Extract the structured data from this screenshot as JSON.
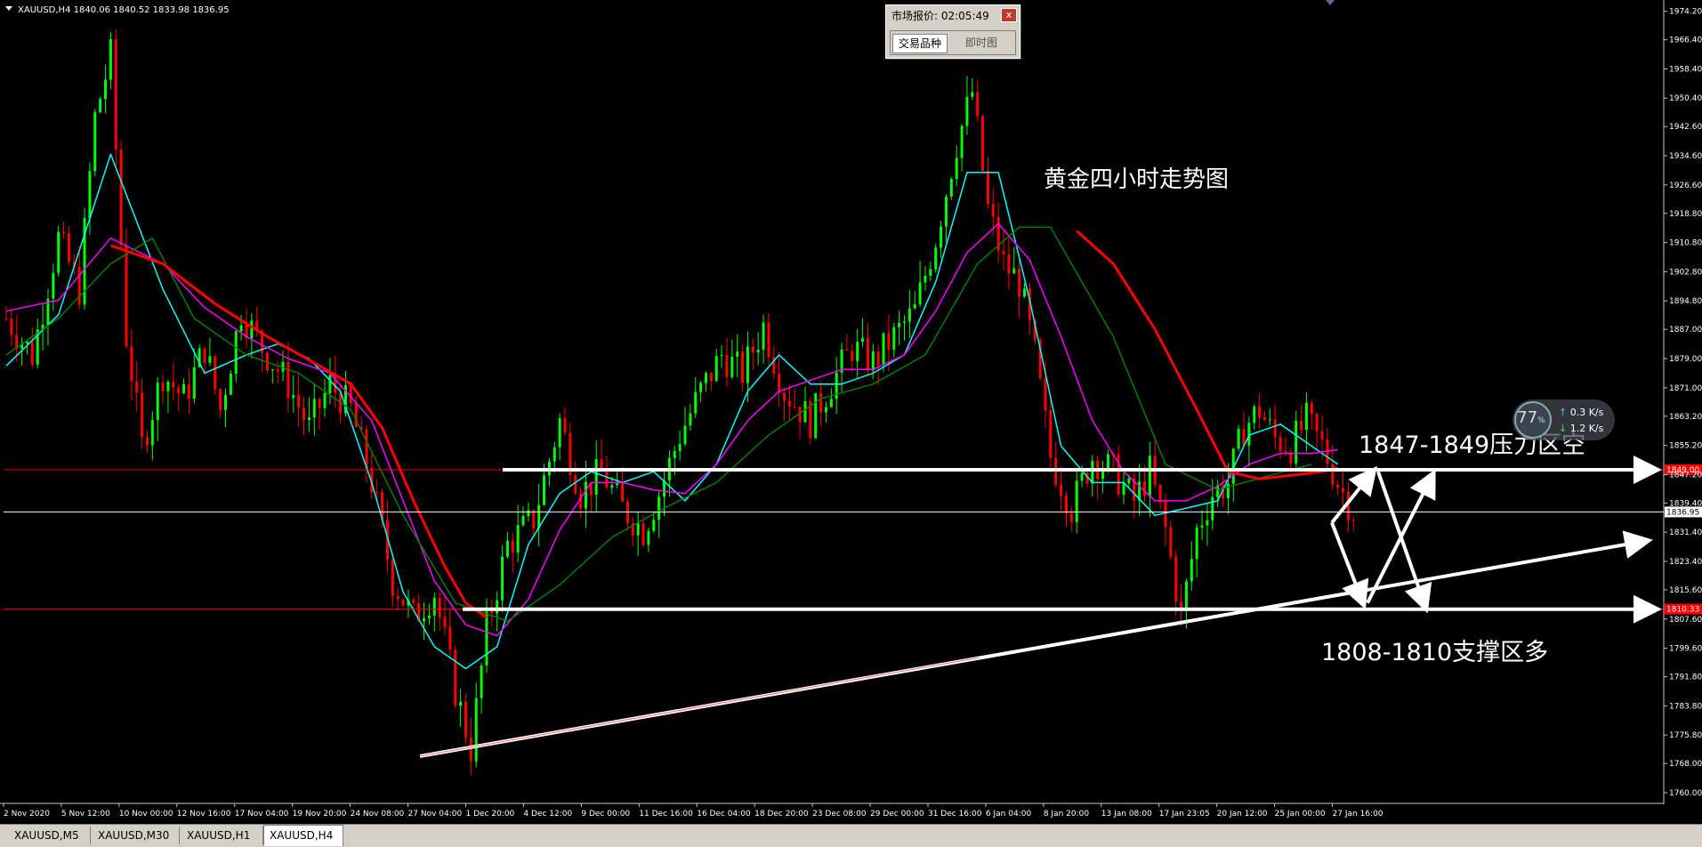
{
  "chart_header": "XAUUSD,H4  1840.06 1840.52 1833.98 1836.95",
  "market_watch": {
    "title": "市场报价: 02:05:49",
    "close": "x",
    "tabs": [
      "交易品种",
      "即时图"
    ]
  },
  "annotations": {
    "chart_title": "黄金四小时走势图",
    "resistance": "1847-1849压力区空",
    "support": "1808-1810支撑区多"
  },
  "network_widget": {
    "percent": "77",
    "percent_unit": "%",
    "up": "0.3",
    "down": "1.2",
    "unit": "K/s"
  },
  "bottom_tabs": [
    "XAUUSD,M5",
    "XAUUSD,M30",
    "XAUUSD,H1",
    "XAUUSD,H4"
  ],
  "active_tab": "XAUUSD,H4",
  "colors": {
    "background": "#000000",
    "bull_candle": "#00ff00",
    "bear_candle": "#ff0000",
    "ma_fast": "#00ffff",
    "ma_mid": "#ff00ff",
    "ma_slow": "#008000",
    "ma_long": "#ff0000",
    "annotation": "#ffffff"
  },
  "chart_data": {
    "type": "candlestick",
    "symbol": "XAUUSD",
    "timeframe": "H4",
    "ylim": [
      1757.3,
      1976.8
    ],
    "y_ticks": [
      "1974.20",
      "1966.40",
      "1958.40",
      "1950.40",
      "1942.60",
      "1934.60",
      "1926.60",
      "1918.80",
      "1910.80",
      "1902.80",
      "1894.80",
      "1887.00",
      "1879.00",
      "1871.00",
      "1863.20",
      "1855.20",
      "1847.20",
      "1839.40",
      "1831.40",
      "1823.40",
      "1815.60",
      "1807.60",
      "1799.60",
      "1791.80",
      "1783.80",
      "1775.80",
      "1768.00",
      "1760.00"
    ],
    "x_ticks": [
      "2 Nov 2020",
      "5 Nov 12:00",
      "10 Nov 00:00",
      "12 Nov 16:00",
      "17 Nov 04:00",
      "19 Nov 20:00",
      "24 Nov 08:00",
      "27 Nov 04:00",
      "1 Dec 20:00",
      "4 Dec 12:00",
      "9 Dec 00:00",
      "11 Dec 16:00",
      "16 Dec 04:00",
      "18 Dec 20:00",
      "23 Dec 08:00",
      "29 Dec 00:00",
      "31 Dec 16:00",
      "6 Jan 04:00",
      "8 Jan 20:00",
      "13 Jan 08:00",
      "17 Jan 23:05",
      "20 Jan 12:00",
      "25 Jan 00:00",
      "27 Jan 16:00"
    ],
    "price_tags": [
      {
        "label": "1849.00",
        "value": 1848.5,
        "color": "#ff0000"
      },
      {
        "label": "1836.95",
        "value": 1836.95,
        "color": "#ffffff"
      },
      {
        "label": "1810.33",
        "value": 1810.33,
        "color": "#ff0000"
      }
    ],
    "path_points": [
      [
        0,
        1890
      ],
      [
        5,
        1880
      ],
      [
        10,
        1912
      ],
      [
        14,
        1898
      ],
      [
        17,
        1945
      ],
      [
        20,
        1962
      ],
      [
        23,
        1885
      ],
      [
        26,
        1855
      ],
      [
        30,
        1875
      ],
      [
        34,
        1868
      ],
      [
        38,
        1882
      ],
      [
        41,
        1865
      ],
      [
        45,
        1892
      ],
      [
        49,
        1882
      ],
      [
        54,
        1872
      ],
      [
        58,
        1860
      ],
      [
        62,
        1872
      ],
      [
        66,
        1865
      ],
      [
        70,
        1845
      ],
      [
        74,
        1818
      ],
      [
        78,
        1808
      ],
      [
        82,
        1815
      ],
      [
        86,
        1788
      ],
      [
        89,
        1772
      ],
      [
        92,
        1805
      ],
      [
        96,
        1828
      ],
      [
        101,
        1835
      ],
      [
        106,
        1862
      ],
      [
        110,
        1842
      ],
      [
        114,
        1848
      ],
      [
        118,
        1838
      ],
      [
        122,
        1832
      ],
      [
        125,
        1842
      ],
      [
        129,
        1858
      ],
      [
        133,
        1870
      ],
      [
        137,
        1880
      ],
      [
        141,
        1875
      ],
      [
        145,
        1888
      ],
      [
        149,
        1870
      ],
      [
        154,
        1862
      ],
      [
        158,
        1872
      ],
      [
        162,
        1882
      ],
      [
        166,
        1878
      ],
      [
        170,
        1885
      ],
      [
        174,
        1892
      ],
      [
        178,
        1912
      ],
      [
        182,
        1938
      ],
      [
        185,
        1952
      ],
      [
        188,
        1920
      ],
      [
        191,
        1905
      ],
      [
        194,
        1900
      ],
      [
        197,
        1880
      ],
      [
        200,
        1852
      ],
      [
        204,
        1838
      ],
      [
        208,
        1852
      ],
      [
        212,
        1848
      ],
      [
        216,
        1840
      ],
      [
        219,
        1848
      ],
      [
        222,
        1832
      ],
      [
        225,
        1808
      ],
      [
        228,
        1832
      ],
      [
        231,
        1842
      ],
      [
        234,
        1845
      ],
      [
        237,
        1860
      ],
      [
        240,
        1865
      ],
      [
        243,
        1857
      ],
      [
        246,
        1855
      ],
      [
        249,
        1862
      ],
      [
        252,
        1855
      ],
      [
        255,
        1845
      ],
      [
        258,
        1837
      ]
    ],
    "moving_averages": [
      {
        "color": "#00ffff",
        "points": [
          [
            0,
            1877
          ],
          [
            10,
            1891
          ],
          [
            20,
            1935
          ],
          [
            30,
            1898
          ],
          [
            38,
            1875
          ],
          [
            46,
            1880
          ],
          [
            52,
            1883
          ],
          [
            58,
            1879
          ],
          [
            64,
            1870
          ],
          [
            70,
            1845
          ],
          [
            76,
            1815
          ],
          [
            82,
            1800
          ],
          [
            88,
            1794
          ],
          [
            94,
            1800
          ],
          [
            100,
            1828
          ],
          [
            106,
            1842
          ],
          [
            112,
            1848
          ],
          [
            118,
            1845
          ],
          [
            124,
            1848
          ],
          [
            130,
            1840
          ],
          [
            136,
            1850
          ],
          [
            142,
            1870
          ],
          [
            148,
            1880
          ],
          [
            154,
            1872
          ],
          [
            160,
            1872
          ],
          [
            166,
            1875
          ],
          [
            172,
            1880
          ],
          [
            178,
            1900
          ],
          [
            184,
            1930
          ],
          [
            190,
            1930
          ],
          [
            196,
            1895
          ],
          [
            202,
            1855
          ],
          [
            208,
            1845
          ],
          [
            214,
            1845
          ],
          [
            220,
            1836
          ],
          [
            226,
            1838
          ],
          [
            232,
            1840
          ],
          [
            238,
            1858
          ],
          [
            244,
            1861
          ],
          [
            250,
            1855
          ],
          [
            255,
            1850
          ]
        ]
      },
      {
        "color": "#ff00ff",
        "points": [
          [
            0,
            1892
          ],
          [
            10,
            1895
          ],
          [
            20,
            1912
          ],
          [
            30,
            1905
          ],
          [
            38,
            1893
          ],
          [
            46,
            1885
          ],
          [
            54,
            1879
          ],
          [
            62,
            1875
          ],
          [
            70,
            1862
          ],
          [
            76,
            1840
          ],
          [
            82,
            1818
          ],
          [
            88,
            1806
          ],
          [
            94,
            1803
          ],
          [
            100,
            1813
          ],
          [
            106,
            1832
          ],
          [
            112,
            1845
          ],
          [
            118,
            1845
          ],
          [
            124,
            1843
          ],
          [
            130,
            1842
          ],
          [
            136,
            1850
          ],
          [
            142,
            1862
          ],
          [
            148,
            1870
          ],
          [
            154,
            1873
          ],
          [
            160,
            1876
          ],
          [
            166,
            1876
          ],
          [
            172,
            1880
          ],
          [
            178,
            1892
          ],
          [
            184,
            1908
          ],
          [
            190,
            1916
          ],
          [
            196,
            1906
          ],
          [
            202,
            1885
          ],
          [
            208,
            1862
          ],
          [
            214,
            1848
          ],
          [
            220,
            1840
          ],
          [
            226,
            1840
          ],
          [
            232,
            1844
          ],
          [
            238,
            1850
          ],
          [
            244,
            1853
          ],
          [
            250,
            1853
          ],
          [
            255,
            1854
          ]
        ]
      },
      {
        "color": "#008000",
        "points": [
          [
            0,
            1880
          ],
          [
            10,
            1890
          ],
          [
            20,
            1905
          ],
          [
            28,
            1912
          ],
          [
            36,
            1890
          ],
          [
            46,
            1880
          ],
          [
            56,
            1875
          ],
          [
            66,
            1865
          ],
          [
            76,
            1836
          ],
          [
            86,
            1812
          ],
          [
            96,
            1807
          ],
          [
            106,
            1817
          ],
          [
            116,
            1830
          ],
          [
            126,
            1838
          ],
          [
            136,
            1845
          ],
          [
            146,
            1858
          ],
          [
            156,
            1868
          ],
          [
            166,
            1872
          ],
          [
            176,
            1880
          ],
          [
            186,
            1905
          ],
          [
            194,
            1915
          ],
          [
            200,
            1915
          ],
          [
            212,
            1885
          ],
          [
            222,
            1850
          ],
          [
            232,
            1843
          ],
          [
            242,
            1847
          ],
          [
            250,
            1850
          ]
        ]
      },
      {
        "color": "#ff0000",
        "points": [
          [
            20,
            1910
          ],
          [
            30,
            1905
          ],
          [
            40,
            1894
          ],
          [
            50,
            1885
          ],
          [
            60,
            1877
          ],
          [
            66,
            1872
          ],
          [
            72,
            1860
          ],
          [
            78,
            1840
          ],
          [
            84,
            1822
          ],
          [
            88,
            1812
          ],
          [
            92,
            1808
          ],
          [
            205,
            1914
          ],
          [
            212,
            1905
          ],
          [
            220,
            1887
          ],
          [
            228,
            1865
          ],
          [
            234,
            1848
          ],
          [
            240,
            1846
          ],
          [
            246,
            1847
          ],
          [
            252,
            1848
          ],
          [
            255,
            1849
          ]
        ]
      }
    ]
  }
}
